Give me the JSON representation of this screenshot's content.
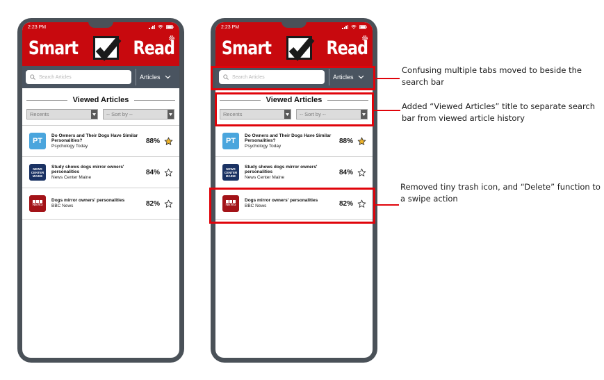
{
  "status_bar": {
    "time": "2:23 PM"
  },
  "app": {
    "logo_left": "Smart",
    "logo_right": "Read",
    "brand_color": "#c8090e"
  },
  "search": {
    "placeholder": "Search Articles"
  },
  "tabs_dropdown": {
    "selected": "Articles"
  },
  "viewed_title": "Viewed Articles",
  "filters": {
    "recents": "Recents",
    "sort_by": "-- Sort by --"
  },
  "articles": [
    {
      "logo": "PT",
      "title": "Do Owners and Their Dogs Have Similar Personalities?",
      "source": "Psychology Today",
      "score": "88%",
      "starred": true
    },
    {
      "logo": "News Center Maine",
      "title": "Study shows dogs mirror owners' personalities",
      "source": "News Center Maine",
      "score": "84%",
      "starred": false
    },
    {
      "logo": "BBC NEWS",
      "title": "Dogs mirror owners' personalities",
      "source": "BBC News",
      "score": "82%",
      "starred": false
    }
  ],
  "ncm_logo_text": {
    "line1": "NEWS",
    "line2": "CENTER",
    "line3": "MAINE"
  },
  "bbc_logo_text": "NEWS",
  "annotations": [
    "Confusing multiple tabs moved to beside the search bar",
    "Added “Viewed Articles” title to separate search bar from viewed article history",
    "Removed tiny trash icon, and “Delete” function to a swipe action"
  ],
  "highlight_color": "#e0040b",
  "icons": [
    "search-icon",
    "chevron-down-icon",
    "gear-icon",
    "star-icon",
    "signal-icon",
    "wifi-icon",
    "battery-icon",
    "checkmark-logo-icon"
  ]
}
